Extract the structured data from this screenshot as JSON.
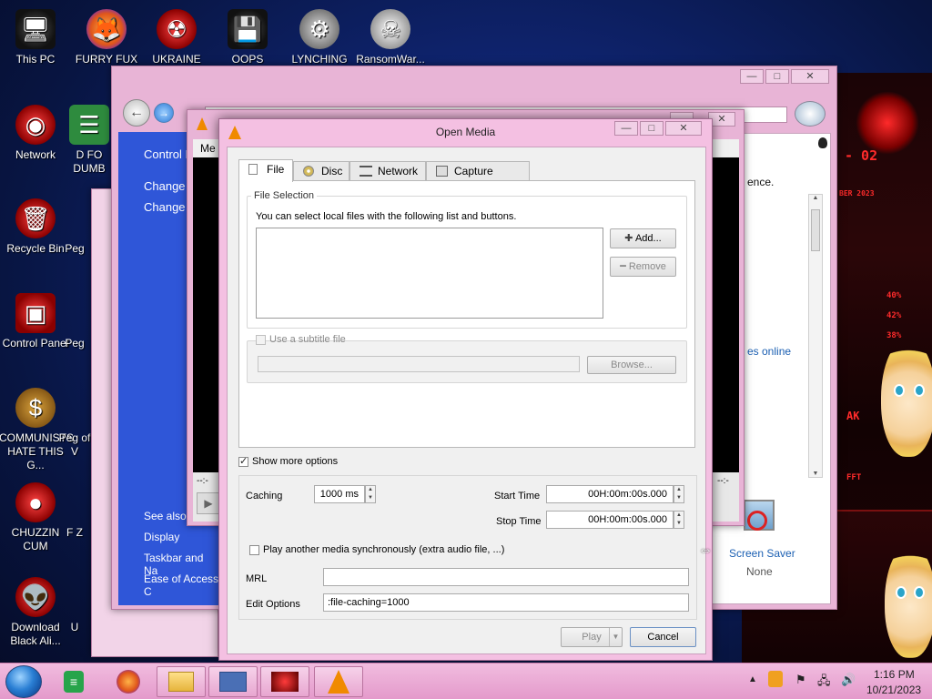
{
  "desktop": {
    "icons": [
      {
        "label": "This PC",
        "icon": "computer-icon"
      },
      {
        "label": "FURRY FUX",
        "icon": "firefox-icon"
      },
      {
        "label": "UKRAINE",
        "icon": "radiation-icon"
      },
      {
        "label": "OOPS",
        "icon": "app-icon"
      },
      {
        "label": "LYNCHING",
        "icon": "game-icon"
      },
      {
        "label": "RansomWar...",
        "icon": "skull-icon"
      },
      {
        "label": "Network",
        "icon": "network-icon"
      },
      {
        "label": "D FO DUMB",
        "icon": "app-icon"
      },
      {
        "label": "Recycle Bin",
        "icon": "recycle-bin-icon"
      },
      {
        "label": "Peg",
        "icon": "app-icon"
      },
      {
        "label": "Control Panel",
        "icon": "control-panel-icon"
      },
      {
        "label": "Peg",
        "icon": "app-icon"
      },
      {
        "label": "COMMUNISTS HATE THIS G...",
        "icon": "money-bag-icon"
      },
      {
        "label": "Peg of V",
        "icon": "app-icon"
      },
      {
        "label": "CHUZZIN CUM",
        "icon": "chuzzle-icon"
      },
      {
        "label": "F Z",
        "icon": "app-icon"
      },
      {
        "label": "Download Black Ali...",
        "icon": "alien-icon"
      },
      {
        "label": "U",
        "icon": "app-icon"
      }
    ]
  },
  "background_window": {
    "sidebar_links": [
      "Control P",
      "Change",
      "Change",
      "See also",
      "Display",
      "Taskbar and Na",
      "Ease of Access C"
    ],
    "right_text": "ence.",
    "right_link": "es online",
    "screen_saver_label": "Screen Saver",
    "screen_saver_value": "None"
  },
  "vlc_window": {
    "menu_partial": "Me",
    "time_left": "--:-",
    "time_right": "--:-"
  },
  "dialog": {
    "title": "Open Media",
    "tabs": [
      {
        "label": "File",
        "icon": "file-icon"
      },
      {
        "label": "Disc",
        "icon": "disc-icon"
      },
      {
        "label": "Network",
        "icon": "network-icon"
      },
      {
        "label": "Capture Device",
        "icon": "capture-device-icon"
      }
    ],
    "file_selection": {
      "group_label": "File Selection",
      "description": "You can select local files with the following list and buttons.",
      "add_button": "Add...",
      "remove_button": "Remove"
    },
    "subtitle": {
      "checkbox_label": "Use a subtitle file",
      "checked": false,
      "path_value": "",
      "browse_button": "Browse..."
    },
    "show_more_options": {
      "label": "Show more options",
      "checked": true
    },
    "caching": {
      "label": "Caching",
      "value": "1000 ms"
    },
    "start_time": {
      "label": "Start Time",
      "value": "00H:00m:00s.000"
    },
    "stop_time": {
      "label": "Stop Time",
      "value": "00H:00m:00s.000"
    },
    "play_another": {
      "label": "Play another media synchronously (extra audio file, ...)",
      "checked": false
    },
    "mrl": {
      "label": "MRL",
      "value": ""
    },
    "edit_options": {
      "label": "Edit Options",
      "value": ":file-caching=1000"
    },
    "play_button": "Play",
    "cancel_button": "Cancel"
  },
  "taskbar": {
    "clock_time": "1:16 PM",
    "clock_date": "10/21/2023"
  },
  "colors": {
    "window_pink": "#f4c0e2",
    "desktop_blue": "#0f2470",
    "control_panel_blue": "#2f56d8"
  }
}
